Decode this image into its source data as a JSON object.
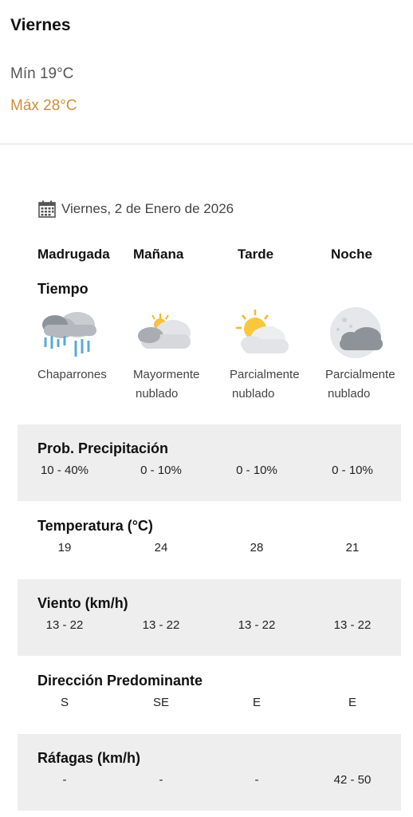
{
  "summary": {
    "day": "Viernes",
    "min": "Mín 19°C",
    "max": "Máx 28°C"
  },
  "forecast": {
    "date": "Viernes, 2 de Enero de 2026",
    "periods": [
      "Madrugada",
      "Mañana",
      "Tarde",
      "Noche"
    ],
    "tiempo_label": "Tiempo",
    "conditions": [
      {
        "icon": "rain-showers-icon",
        "line1": "Chaparrones",
        "line2": ""
      },
      {
        "icon": "mostly-cloudy-icon",
        "line1": "Mayormente",
        "line2": "nublado"
      },
      {
        "icon": "partly-cloudy-day-icon",
        "line1": "Parcialmente",
        "line2": "nublado"
      },
      {
        "icon": "partly-cloudy-night-icon",
        "line1": "Parcialmente",
        "line2": "nublado"
      }
    ],
    "rows": [
      {
        "title": "Prob. Precipitación",
        "values": [
          "10 - 40%",
          "0 - 10%",
          "0 - 10%",
          "0 - 10%"
        ]
      },
      {
        "title": "Temperatura (°C)",
        "values": [
          "19",
          "24",
          "28",
          "21"
        ]
      },
      {
        "title": "Viento (km/h)",
        "values": [
          "13 - 22",
          "13 - 22",
          "13 - 22",
          "13 - 22"
        ]
      },
      {
        "title": "Dirección Predominante",
        "values": [
          "S",
          "SE",
          "E",
          "E"
        ]
      },
      {
        "title": "Ráfagas (km/h)",
        "values": [
          "-",
          "-",
          "-",
          "42 - 50"
        ]
      }
    ]
  },
  "colors": {
    "max_temp": "#c9903a",
    "band_gray": "#eeeeee"
  }
}
